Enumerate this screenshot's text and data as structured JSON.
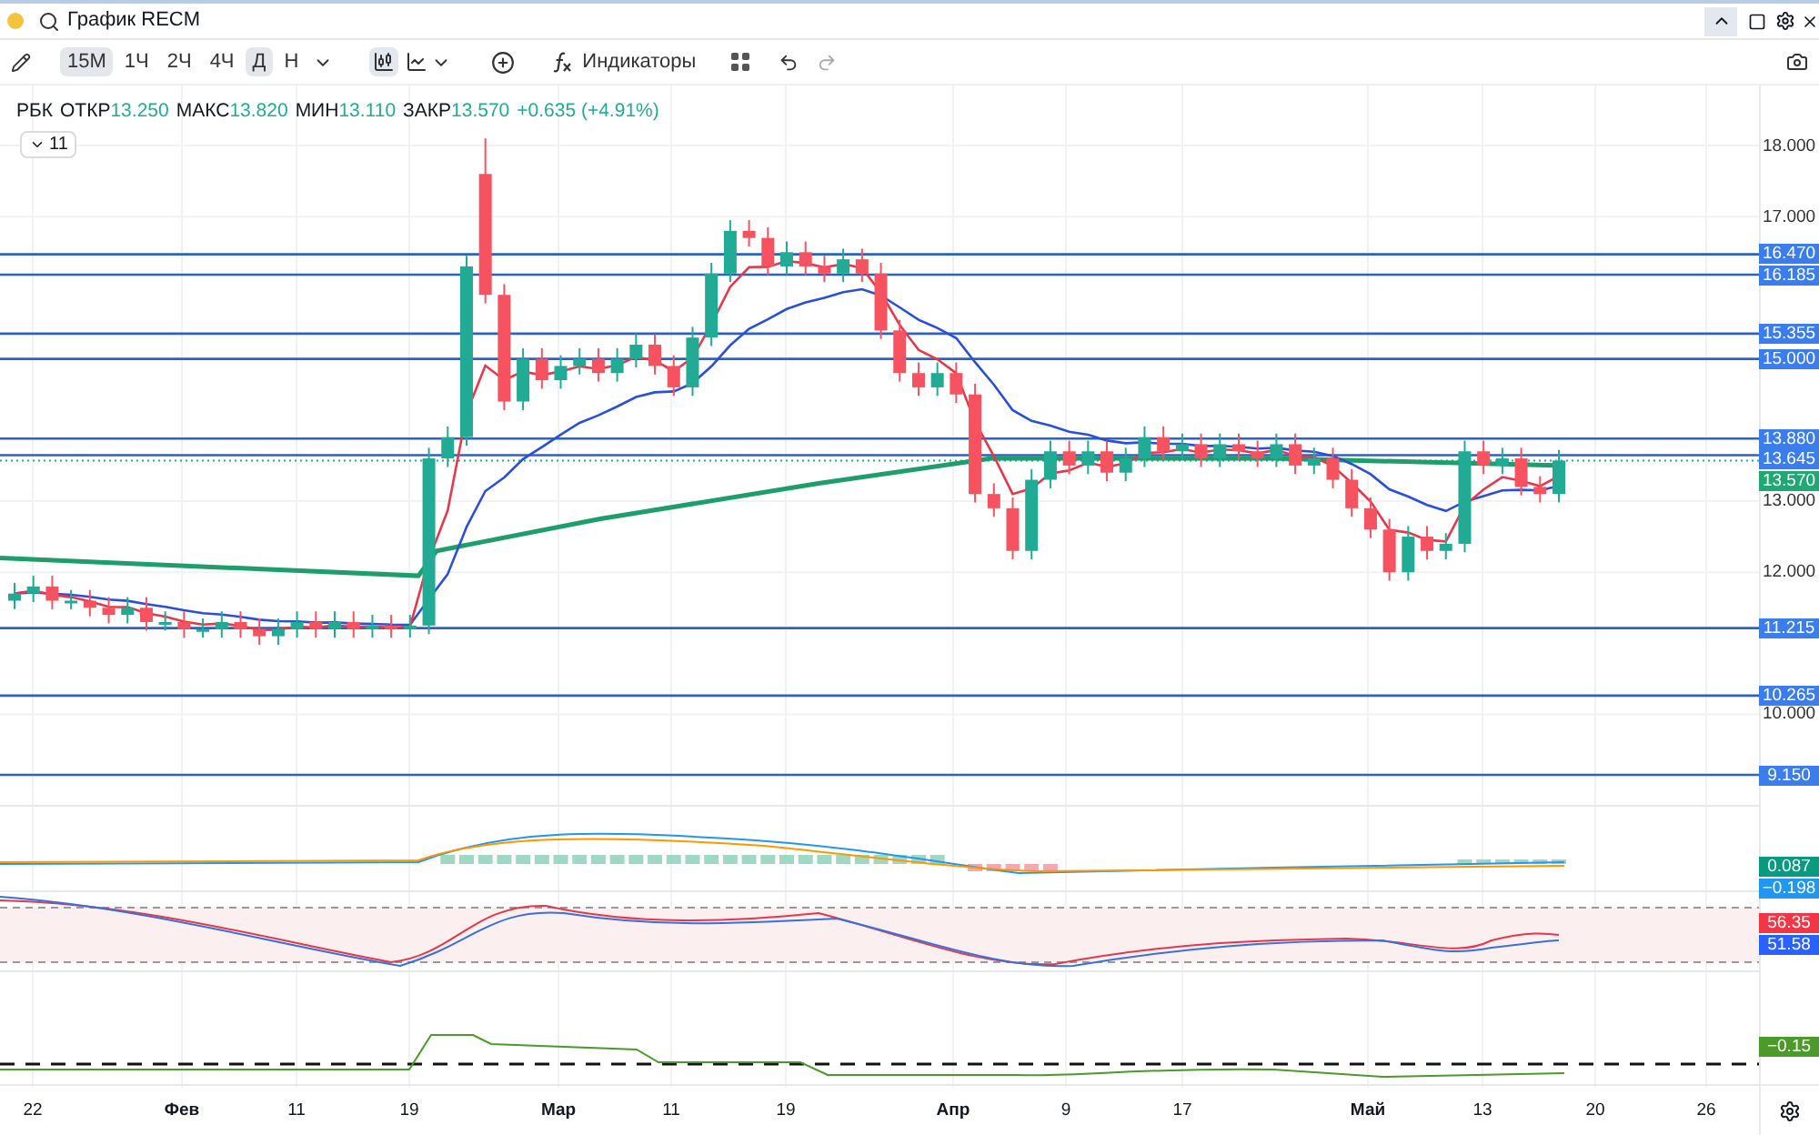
{
  "window": {
    "title": "График RECM"
  },
  "toolbar": {
    "intervals": [
      {
        "label": "15М",
        "selected": true
      },
      {
        "label": "1Ч",
        "selected": false
      },
      {
        "label": "2Ч",
        "selected": false
      },
      {
        "label": "4Ч",
        "selected": false
      },
      {
        "label": "Д",
        "selected": true
      },
      {
        "label": "Н",
        "selected": false
      }
    ],
    "indicators_label": "Индикаторы"
  },
  "legend": {
    "symbol": "РБК",
    "items": [
      {
        "label": "ОТКР",
        "value": "13.250"
      },
      {
        "label": "МАКС",
        "value": "13.820"
      },
      {
        "label": "МИН",
        "value": "13.110"
      },
      {
        "label": "ЗАКР",
        "value": "13.570"
      }
    ],
    "change": "+0.635 (+4.91%)",
    "collapsed_count": "11"
  },
  "price_axis": {
    "ticks": [
      "18.000",
      "17.000",
      "13.000",
      "12.000",
      "10.000"
    ],
    "levels": [
      {
        "value": "16.470",
        "kind": "level"
      },
      {
        "value": "16.185",
        "kind": "level"
      },
      {
        "value": "15.355",
        "kind": "level"
      },
      {
        "value": "15.000",
        "kind": "level"
      },
      {
        "value": "13.880",
        "kind": "level"
      },
      {
        "value": "13.645",
        "kind": "level"
      },
      {
        "value": "13.570",
        "kind": "last"
      },
      {
        "value": "11.215",
        "kind": "level"
      },
      {
        "value": "10.265",
        "kind": "level"
      },
      {
        "value": "9.150",
        "kind": "level"
      }
    ]
  },
  "indicators": [
    {
      "labels": [
        {
          "text": "0.087",
          "color": "#089981"
        },
        {
          "text": "−0.198",
          "color": "#2196f3"
        }
      ]
    },
    {
      "labels": [
        {
          "text": "56.35",
          "color": "#f23645"
        },
        {
          "text": "51.58",
          "color": "#2962ff"
        }
      ]
    },
    {
      "labels": [
        {
          "text": "−0.15",
          "color": "#4b9a2a"
        }
      ]
    }
  ],
  "time_axis": [
    {
      "label": "22",
      "kind": "day"
    },
    {
      "label": "Фев",
      "kind": "month"
    },
    {
      "label": "11",
      "kind": "day"
    },
    {
      "label": "19",
      "kind": "day"
    },
    {
      "label": "Мар",
      "kind": "month"
    },
    {
      "label": "11",
      "kind": "day"
    },
    {
      "label": "19",
      "kind": "day"
    },
    {
      "label": "Апр",
      "kind": "month"
    },
    {
      "label": "9",
      "kind": "day"
    },
    {
      "label": "17",
      "kind": "day"
    },
    {
      "label": "Май",
      "kind": "month"
    },
    {
      "label": "13",
      "kind": "day"
    },
    {
      "label": "20",
      "kind": "day"
    },
    {
      "label": "26",
      "kind": "day"
    }
  ]
}
